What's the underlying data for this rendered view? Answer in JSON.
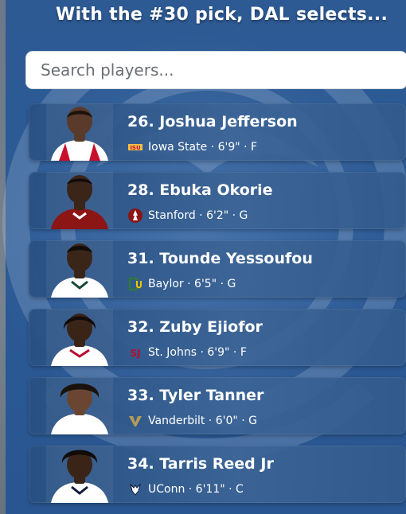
{
  "header": {
    "title": "With the #30 pick, DAL selects..."
  },
  "search": {
    "placeholder": "Search players..."
  },
  "players": [
    {
      "name": "26. Joshua Jefferson",
      "meta": "Iowa State · 6'9\" · F",
      "school_icon": "iowa-state-logo-icon",
      "jersey": "#ffffff",
      "accent": "#c8102e",
      "skin": "#5a3a2a"
    },
    {
      "name": "28. Ebuka Okorie",
      "meta": "Stanford · 6'2\" · G",
      "school_icon": "stanford-logo-icon",
      "jersey": "#8c1515",
      "accent": "#ffffff",
      "skin": "#3b2418"
    },
    {
      "name": "31. Tounde Yessoufou",
      "meta": "Baylor · 6'5\" · G",
      "school_icon": "baylor-logo-icon",
      "jersey": "#ffffff",
      "accent": "#154734",
      "skin": "#3a2519"
    },
    {
      "name": "32. Zuby Ejiofor",
      "meta": "St. Johns · 6'9\" · F",
      "school_icon": "st-johns-logo-icon",
      "jersey": "#ffffff",
      "accent": "#ba0c2f",
      "skin": "#3a2418"
    },
    {
      "name": "33. Tyler Tanner",
      "meta": "Vanderbilt · 6'0\" · G",
      "school_icon": "vanderbilt-logo-icon",
      "jersey": "#ffffff",
      "accent": "#000000",
      "skin": "#6a4632"
    },
    {
      "name": "34. Tarris Reed Jr",
      "meta": "UConn · 6'11\" · C",
      "school_icon": "uconn-logo-icon",
      "jersey": "#ffffff",
      "accent": "#0e1a3a",
      "skin": "#3a2418"
    }
  ]
}
